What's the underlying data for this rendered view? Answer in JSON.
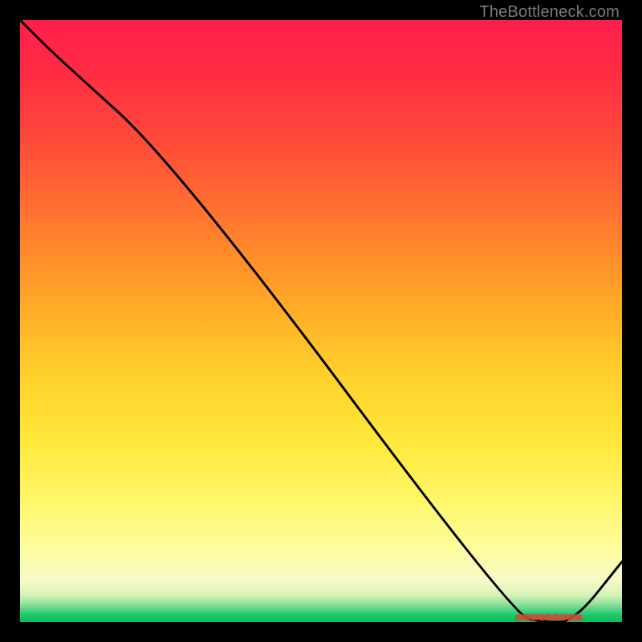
{
  "watermark": "TheBottleneck.com",
  "chart_data": {
    "type": "line",
    "title": "",
    "xlabel": "",
    "ylabel": "",
    "xlim": [
      0,
      100
    ],
    "ylim": [
      0,
      100
    ],
    "grid": false,
    "legend": false,
    "x": [
      0,
      6,
      26,
      82,
      87,
      92,
      100
    ],
    "values": [
      100,
      94,
      76,
      1,
      0,
      0,
      10
    ],
    "line_color": "#000000",
    "marker_cluster": {
      "y": 0.8,
      "x_positions": [
        83,
        84.2,
        85.4,
        86.6,
        87.8,
        89,
        90.2,
        91.4,
        92.6
      ],
      "color": "#d4473a"
    },
    "background_gradient_stops": [
      {
        "pos": 0.0,
        "color": "#ff1f4c"
      },
      {
        "pos": 0.34,
        "color": "#ff7a2e"
      },
      {
        "pos": 0.7,
        "color": "#ffe83a"
      },
      {
        "pos": 0.93,
        "color": "#f7fac8"
      },
      {
        "pos": 1.0,
        "color": "#0abf5a"
      }
    ]
  }
}
